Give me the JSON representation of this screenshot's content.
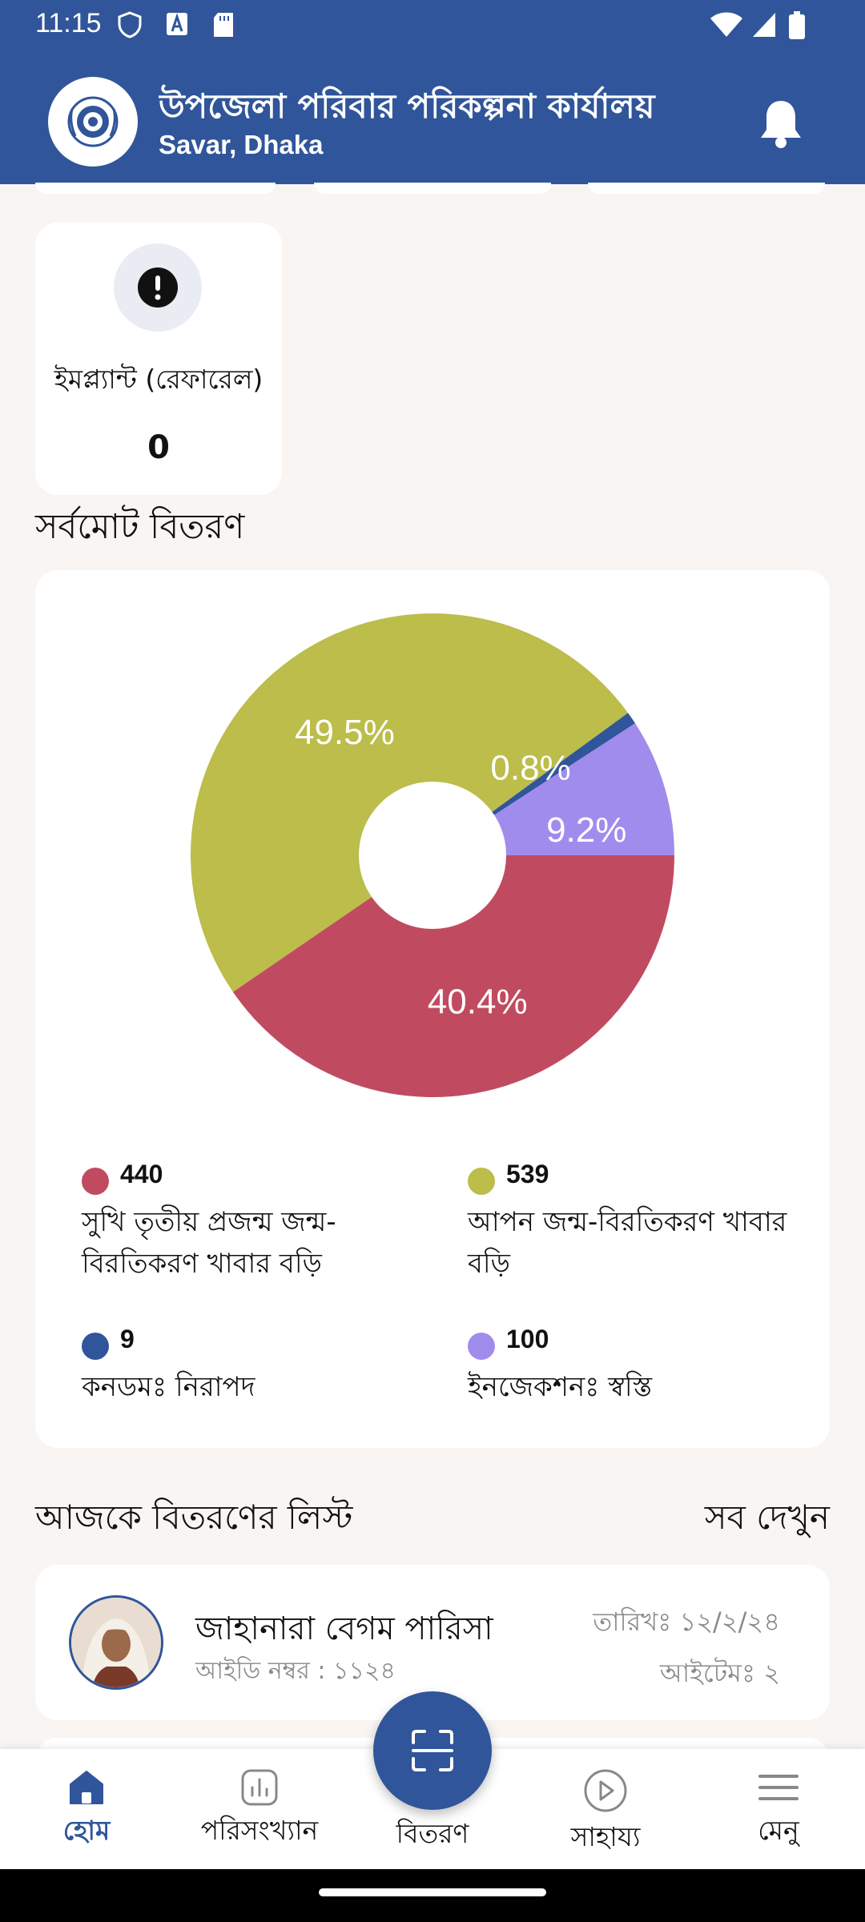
{
  "status_bar": {
    "time": "11:15",
    "icons": [
      "shield-icon",
      "a-box-icon",
      "sd-card-icon",
      "wifi-icon",
      "signal-icon",
      "battery-icon"
    ]
  },
  "header": {
    "title": "উপজেলা পরিবার পরিকল্পনা কার্যালয়",
    "subtitle": "Savar, Dhaka",
    "icons": [
      "logo-emblem",
      "bell-icon"
    ]
  },
  "implant_card": {
    "label": "ইমপ্ল্যান্ট (রেফারেল)",
    "value": "0",
    "icon": "exclamation-icon"
  },
  "distribution_section": {
    "title": "সর্বমোট বিতরণ"
  },
  "chart_data": {
    "type": "pie",
    "donut": true,
    "slices": [
      {
        "label": "সুখি তৃতীয় প্রজন্ম জন্ম-বিরতিকরণ খাবার বড়ি",
        "value": 440,
        "percent_label": "40.4%",
        "color": "#c04b60"
      },
      {
        "label": "আপন জন্ম-বিরতিকরণ খাবার বড়ি",
        "value": 539,
        "percent_label": "49.5%",
        "color": "#bcbd4a"
      },
      {
        "label": "কনডমঃ নিরাপদ",
        "value": 9,
        "percent_label": "0.8%",
        "color": "#30559a"
      },
      {
        "label": "ইনজেকশনঃ স্বস্তি",
        "value": 100,
        "percent_label": "9.2%",
        "color": "#a08ced"
      }
    ]
  },
  "today_list": {
    "title": "আজকে বিতরণের লিস্ট",
    "see_all": "সব দেখুন",
    "items": [
      {
        "name": "জাহানারা বেগম পারিসা",
        "id_text": "আইডি নম্বর : ১১২৪",
        "date_text": "তারিখঃ ১২/২/২৪",
        "items_text": "আইটেমঃ ২"
      }
    ]
  },
  "bottom_nav": {
    "home": "হোম",
    "stats": "পরিসংখ্যান",
    "distribution": "বিতরণ",
    "help": "সাহায্য",
    "menu": "মেনু"
  },
  "colors": {
    "primary": "#30559a",
    "background": "#f8f5f3"
  }
}
